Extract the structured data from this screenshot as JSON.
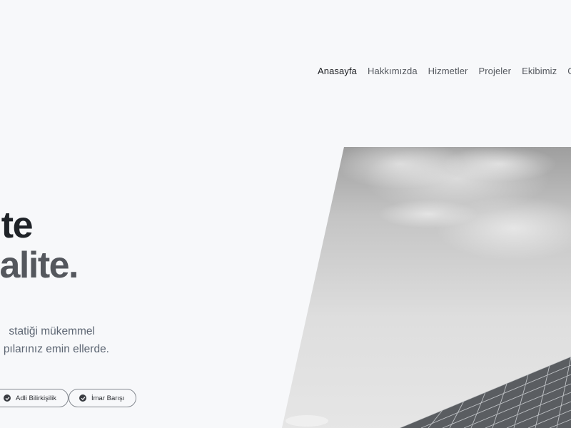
{
  "nav": {
    "items": [
      {
        "label": "Anasayfa",
        "active": true
      },
      {
        "label": "Hakkımızda",
        "active": false
      },
      {
        "label": "Hizmetler",
        "active": false
      },
      {
        "label": "Projeler",
        "active": false
      },
      {
        "label": "Ekibimiz",
        "active": false
      },
      {
        "label": "Ga",
        "active": false
      }
    ]
  },
  "hero": {
    "headline_line1": "te",
    "headline_line2": "alite.",
    "lead_line1": "statiği mükemmel",
    "lead_line2": "pılarınız emin ellerde.",
    "badges": [
      {
        "label": "Adli Bilirkişilik",
        "icon": "check-circle-icon"
      },
      {
        "label": "İmar Barışı",
        "icon": "check-circle-icon"
      }
    ]
  },
  "colors": {
    "background": "#f7f8fa",
    "headline_dark": "#1f2328",
    "headline_gray": "#54575d",
    "text_muted": "#5d6673",
    "badge_border": "#858a91"
  }
}
